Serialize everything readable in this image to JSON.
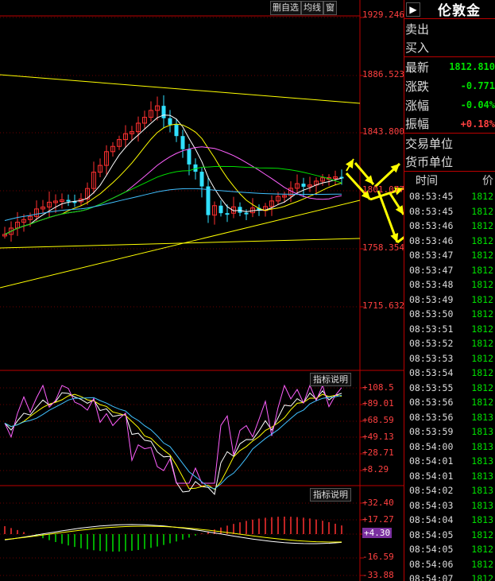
{
  "toolbar": {
    "delete_fav": "删自选",
    "ma_lines": "均线",
    "window": "窗"
  },
  "price_axis": [
    "1929.246",
    "1886.523",
    "1843.800",
    "1801.077",
    "1758.354",
    "1715.632"
  ],
  "indicator1": {
    "button": "指标说明",
    "axis": [
      "+108.5",
      "+89.01",
      "+68.59",
      "+49.13",
      "+28.71",
      "+8.29"
    ]
  },
  "indicator2": {
    "button": "指标说明",
    "axis": [
      "+32.40",
      "+17.27",
      "+4.30",
      "-16.59",
      "-33.88"
    ]
  },
  "colors": {
    "up": "#ff3030",
    "down": "#30e0ff",
    "green": "#00e000",
    "yellow": "#ffff00",
    "magenta": "#ff60ff",
    "axis_red": "#ff4040"
  },
  "panel": {
    "arrow_icon": "▶",
    "title": "伦敦金",
    "sell": "卖出",
    "buy": "买入",
    "latest_label": "最新",
    "latest_value": "1812.810",
    "change_label": "涨跌",
    "change_value": "-0.771",
    "pct_label": "涨幅",
    "pct_value": "-0.04%",
    "amp_label": "振幅",
    "amp_value": "+0.18%",
    "trade_unit_label": "交易单位",
    "currency_unit_label": "货币单位",
    "ticks_time_header": "时间",
    "ticks_price_header": "价"
  },
  "ticks": [
    {
      "time": "08:53:45",
      "price": "1812"
    },
    {
      "time": "08:53:45",
      "price": "1812"
    },
    {
      "time": "08:53:46",
      "price": "1812"
    },
    {
      "time": "08:53:46",
      "price": "1812"
    },
    {
      "time": "08:53:47",
      "price": "1812"
    },
    {
      "time": "08:53:47",
      "price": "1812"
    },
    {
      "time": "08:53:48",
      "price": "1812"
    },
    {
      "time": "08:53:49",
      "price": "1812"
    },
    {
      "time": "08:53:50",
      "price": "1812"
    },
    {
      "time": "08:53:51",
      "price": "1812"
    },
    {
      "time": "08:53:52",
      "price": "1812"
    },
    {
      "time": "08:53:53",
      "price": "1812"
    },
    {
      "time": "08:53:54",
      "price": "1812"
    },
    {
      "time": "08:53:55",
      "price": "1812"
    },
    {
      "time": "08:53:56",
      "price": "1812"
    },
    {
      "time": "08:53:56",
      "price": "1813"
    },
    {
      "time": "08:53:59",
      "price": "1813"
    },
    {
      "time": "08:54:00",
      "price": "1813"
    },
    {
      "time": "08:54:01",
      "price": "1813"
    },
    {
      "time": "08:54:01",
      "price": "1813"
    },
    {
      "time": "08:54:02",
      "price": "1813"
    },
    {
      "time": "08:54:03",
      "price": "1813"
    },
    {
      "time": "08:54:04",
      "price": "1813"
    },
    {
      "time": "08:54:05",
      "price": "1812"
    },
    {
      "time": "08:54:05",
      "price": "1812"
    },
    {
      "time": "08:54:06",
      "price": "1812"
    },
    {
      "time": "08:54:07",
      "price": "1812"
    }
  ]
}
